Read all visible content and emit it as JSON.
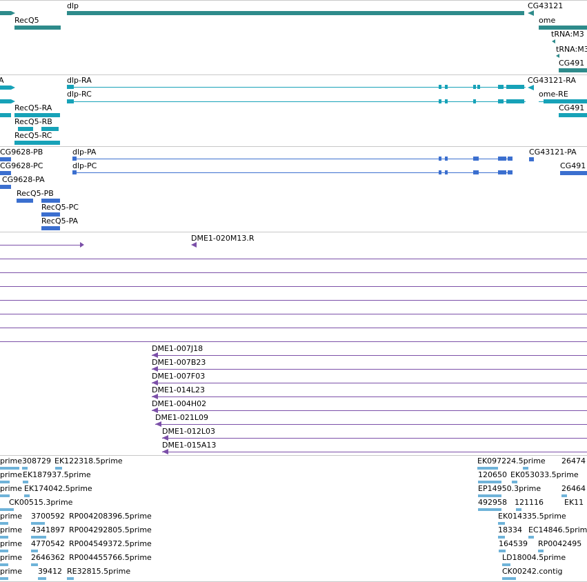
{
  "colors": {
    "gene": "#2e8b8b",
    "transcript": "#17a2b8",
    "cds": "#3b6fcf",
    "clone": "#7b4fa8",
    "est": "#6fb3d9"
  },
  "genes_track": {
    "labels": [
      "RecQ5",
      "dlp",
      "CG43121",
      "ome",
      "tRNA:M3",
      "tRNA:M3",
      "CG491"
    ]
  },
  "transcripts_track": {
    "labels": [
      "A",
      "dlp-RA",
      "dlp-RC",
      "CG43121-RA",
      "ome-RE",
      "RecQ5-RA",
      "RecQ5-RB",
      "RecQ5-RC",
      "CG491"
    ]
  },
  "cds_track": {
    "labels": [
      "CG9628-PB",
      "CG9628-PC",
      "CG9628-PA",
      "dlp-PA",
      "dlp-PC",
      "CG43121-PA",
      "CG491",
      "RecQ5-PB",
      "RecQ5-PC",
      "RecQ5-PA"
    ]
  },
  "clones_track": {
    "labels": [
      "DME1-020M13.R",
      "DME1-007J18",
      "DME1-007B23",
      "DME1-007F03",
      "DME1-014L23",
      "DME1-004H02",
      "DME1-021L09",
      "DME1-012L03",
      "DME1-015A13"
    ]
  },
  "est_track": {
    "labels": [
      "prime",
      "308729",
      "EK122318.5prime",
      "prime",
      "EK187937.5prime",
      "prime",
      "EK174042.5prime",
      "CK00515.3prime",
      "prime",
      "3700592",
      "RP004208396.5prime",
      "prime",
      "4341897",
      "RP004292805.5prime",
      "prime",
      "4770542",
      "RP004549372.5prime",
      "prime",
      "2646362",
      "RP004455766.5prime",
      "prime",
      "39412",
      "RE32815.5prime",
      "EK097224.5prime",
      "26474",
      "120650",
      "EK053033.5prime",
      "EP14950.3prime",
      "26464",
      "492958",
      "121116",
      "EK11",
      "EK014335.5prime",
      "18334",
      "EC14846.5prime",
      "164539",
      "RP0042495",
      "LD18004.5prime",
      "CK00242.contig"
    ]
  }
}
